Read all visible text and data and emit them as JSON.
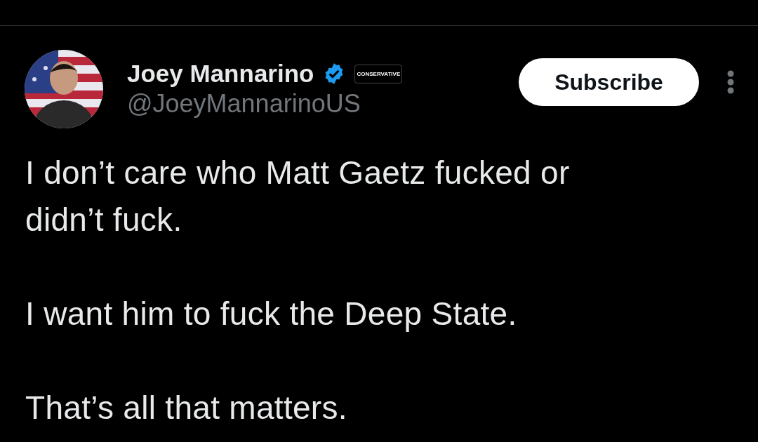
{
  "author": {
    "name": "Joey Mannarino",
    "handle": "@JoeyMannarinoUS",
    "verified": true,
    "affiliation": "CONSERVATIVE"
  },
  "subscribe_button": "Subscribe",
  "post": {
    "paragraphs": [
      "I don’t care who Matt Gaetz fucked or didn’t fuck.",
      "I want him to fuck the Deep State.",
      "That’s all that matters."
    ]
  }
}
